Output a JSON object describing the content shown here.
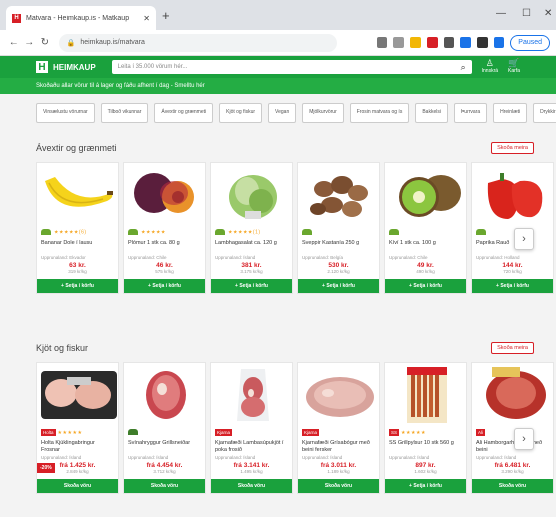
{
  "browser": {
    "tab_title": "Matvara - Heimkaup.is - Matkaup",
    "url": "heimkaup.is/matvara",
    "synced_label": "Paused"
  },
  "site": {
    "logo_letter": "H",
    "logo_text": "HEIMKAUP",
    "search_placeholder": "Leita í 35.000 vörum hér...",
    "header_icons": [
      {
        "icon": "user-icon",
        "label": "Innskrá"
      },
      {
        "icon": "cart-icon",
        "label": "Karfa"
      }
    ],
    "promo_text": "Skoðaðu allar vörur til á lager og fáðu afhent í dag - Smelltu hér"
  },
  "categories": [
    "Vinsælustu vörurnar",
    "Tilboð vikunnar",
    "Ávextir og grænmeti",
    "Kjöt og fiskur",
    "Vegan",
    "Mjólkurvörur",
    "Frosin matvara og ís",
    "Bakkelsi",
    "Þurrvara",
    "Hreinlæti",
    "Drykkir"
  ],
  "sections": [
    {
      "title": "Ávextir og grænmeti",
      "see_more": "Skoða meira",
      "products": [
        {
          "name": "Bananar Dole í lausu",
          "origin": "Upprunaland: Ekvador",
          "price": "63 kr.",
          "unit": "319 kr/kg",
          "buy": "+ Setja í körfu",
          "rating": "★★★★★",
          "count": "(6)"
        },
        {
          "name": "Plómur 1 stk ca. 80 g",
          "origin": "Upprunaland: Chile",
          "price": "46 kr.",
          "unit": "575 kr/kg",
          "buy": "+ Setja í körfu",
          "rating": "★★★★★",
          "count": ""
        },
        {
          "name": "Lambhagasalat ca. 120 g",
          "origin": "Upprunaland: Ísland",
          "price": "381 kr.",
          "unit": "3.175 kr/kg",
          "buy": "+ Setja í körfu",
          "rating": "★★★★★",
          "count": "(1)"
        },
        {
          "name": "Sveppir Kastanía 250 g",
          "origin": "Upprunaland: Belgía",
          "price": "530 kr.",
          "unit": "2.120 kr/kg",
          "buy": "+ Setja í körfu",
          "rating": "",
          "count": ""
        },
        {
          "name": "Kíví 1 stk ca. 100 g",
          "origin": "Upprunaland: Chile",
          "price": "49 kr.",
          "unit": "490 kr/kg",
          "buy": "+ Setja í körfu",
          "rating": "",
          "count": ""
        },
        {
          "name": "Paprika Rauð",
          "origin": "Upprunaland: Holland",
          "price": "144 kr.",
          "unit": "720 kr/kg",
          "buy": "+ Setja í körfu",
          "rating": "",
          "count": ""
        }
      ]
    },
    {
      "title": "Kjöt og fiskur",
      "see_more": "Skoða meira",
      "products": [
        {
          "name": "Holta Kjúklingabringur Frosnar",
          "origin": "Upprunaland: Ísland",
          "price": "frá 1.425 kr.",
          "unit": "2.849 kr/kg",
          "buy": "Skoða vöru",
          "rating": "★★★★★",
          "count": "",
          "discount": "-20%",
          "brand": "Holta"
        },
        {
          "name": "Svínahryggur Grillsneiðar",
          "origin": "Upprunaland: Ísland",
          "price": "frá 4.454 kr.",
          "unit": "3.712 kr/kg",
          "buy": "Skoða vöru",
          "rating": "",
          "count": ""
        },
        {
          "name": "Kjarnafæði Lambasúpukjöt í poka frosið",
          "origin": "Upprunaland: Ísland",
          "price": "frá 3.141 kr.",
          "unit": "1.495 kr/kg",
          "buy": "Skoða vöru",
          "rating": "",
          "count": "",
          "brand": "Kjarna"
        },
        {
          "name": "Kjarnafæði Grísabógur með beini fersker",
          "origin": "Upprunaland: Ísland",
          "price": "frá 3.011 kr.",
          "unit": "1.189 kr/kg",
          "buy": "Skoða vöru",
          "rating": "",
          "count": "",
          "brand": "Kjarna"
        },
        {
          "name": "SS Grillpylsur 10 stk 560 g",
          "origin": "Upprunaland: Ísland",
          "price": "897 kr.",
          "unit": "1.602 kr/kg",
          "buy": "+ Setja í körfu",
          "rating": "★★★★★",
          "count": "",
          "brand": "SS"
        },
        {
          "name": "Ali Hamborgarhryggur með beini",
          "origin": "Upprunaland: Ísland",
          "price": "frá 6.481 kr.",
          "unit": "3.290 kr/kg",
          "buy": "Skoða vöru",
          "rating": "",
          "count": "",
          "brand": "Ali"
        }
      ]
    }
  ]
}
